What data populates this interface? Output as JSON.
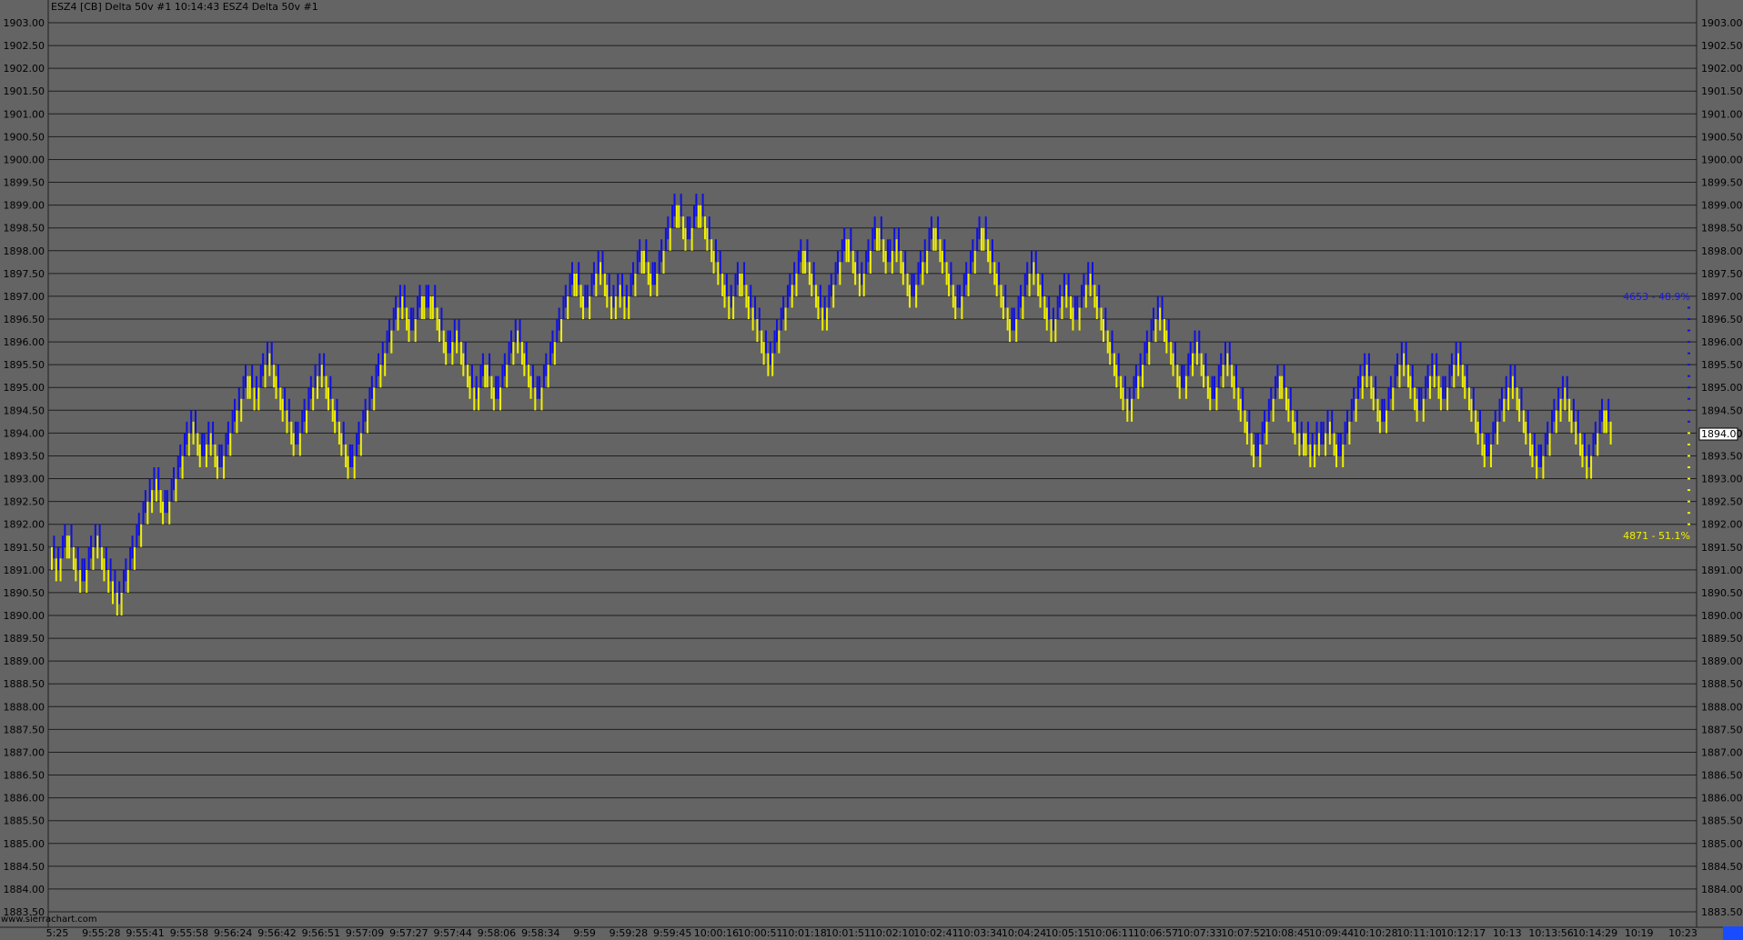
{
  "chart_title": "ESZ4 [CB]  Delta 50v  #1 10:14:43 ESZ4 Delta 50v  #1",
  "watermark": "www.sierrachart.com",
  "current_price_label": "1894.00",
  "colors": {
    "background": "#646464",
    "grid": "#1e1e1e",
    "up_bar": "#1010e0",
    "down_bar": "#f0f000",
    "buy_text": "#1a1ae6",
    "sell_text": "#f0f000",
    "corner_box": "#1a4cff"
  },
  "chart_data": {
    "type": "bar",
    "title": "ESZ4 [CB]  Delta 50v  #1 10:14:43 ESZ4 Delta 50v  #1",
    "ylim": [
      1883.25,
      1903.25
    ],
    "y_ticks": [
      "1903.00",
      "1902.50",
      "1902.00",
      "1901.50",
      "1901.00",
      "1900.50",
      "1900.00",
      "1899.50",
      "1899.00",
      "1898.50",
      "1898.00",
      "1897.50",
      "1897.00",
      "1896.50",
      "1896.00",
      "1895.50",
      "1895.00",
      "1894.50",
      "1894.00",
      "1893.50",
      "1893.00",
      "1892.50",
      "1892.00",
      "1891.50",
      "1891.00",
      "1890.50",
      "1890.00",
      "1889.50",
      "1889.00",
      "1888.50",
      "1888.00",
      "1887.50",
      "1887.00",
      "1886.50",
      "1886.00",
      "1885.50",
      "1885.00",
      "1884.50",
      "1884.00",
      "1883.50"
    ],
    "x_ticks": [
      "5:25",
      "9:55:28",
      "9:55:41",
      "9:55:58",
      "9:56:24",
      "9:56:42",
      "9:56:51",
      "9:57:09",
      "9:57:27",
      "9:57:44",
      "9:58:06",
      "9:58:34",
      "9:59",
      "9:59:28",
      "9:59:45",
      "10:00:16",
      "10:00:51",
      "10:01:18",
      "10:01:51",
      "10:02:10",
      "10:02:41",
      "10:03:34",
      "10:04:24",
      "10:05:15",
      "10:06:11",
      "10:06:57",
      "10:07:33",
      "10:07:52",
      "10:08:45",
      "10:09:44",
      "10:10:28",
      "10:11:10",
      "10:12:17",
      "10:13",
      "10:13:56",
      "10:14:29",
      "10:19",
      "10:23"
    ],
    "path": [
      1891.5,
      1891.0,
      1891.75,
      1891.0,
      1890.75,
      1891.25,
      1891.75,
      1891.0,
      1890.75,
      1890.25,
      1891.25,
      1892.5,
      1893.0,
      1892.25,
      1893.25,
      1893.75,
      1894.25,
      1893.5,
      1894.0,
      1893.25,
      1894.5,
      1895.25,
      1894.75,
      1895.75,
      1895.25,
      1894.5,
      1893.75,
      1895.0,
      1895.5,
      1894.5,
      1893.25,
      1895.5,
      1897.0,
      1896.25,
      1897.0,
      1896.75,
      1897.0,
      1895.75,
      1896.25,
      1895.25,
      1894.75,
      1895.5,
      1894.75,
      1896.25,
      1895.0,
      1894.75,
      1896.75,
      1897.5,
      1896.75,
      1897.25,
      1897.75,
      1896.75,
      1897.25,
      1896.75,
      1897.75,
      1898.0,
      1897.25,
      1898.75,
      1899.0,
      1898.25,
      1899.0,
      1897.75,
      1896.75,
      1897.5,
      1896.75,
      1896.5,
      1895.5,
      1897.25,
      1898.0,
      1896.5,
      1898.25,
      1897.25,
      1898.5,
      1897.75,
      1898.25,
      1897.0,
      1897.75,
      1898.5,
      1896.75,
      1898.5,
      1897.0,
      1896.25,
      1897.75,
      1897.25,
      1896.25,
      1897.25,
      1896.5,
      1897.5,
      1896.0,
      1895.0,
      1894.5,
      1895.25,
      1896.75,
      1895.0,
      1896.0,
      1894.75,
      1895.75,
      1894.25,
      1893.5,
      1895.25,
      1893.75,
      1894.0,
      1893.5,
      1894.0,
      1893.75,
      1894.25,
      1893.5,
      1895.5,
      1894.25,
      1895.75,
      1894.5,
      1895.5,
      1894.75,
      1895.25,
      1895.75,
      1894.75,
      1893.5,
      1894.75,
      1895.25,
      1893.75,
      1893.5,
      1893.25,
      1893.75,
      1894.5,
      1895.0,
      1894.25,
      1893.25,
      1894.5,
      1894.0
    ],
    "volume_profile": [
      {
        "label": "4653 - 48.9%",
        "color": "buy"
      },
      {
        "label": "4871 - 51.1%",
        "color": "sell"
      }
    ]
  }
}
